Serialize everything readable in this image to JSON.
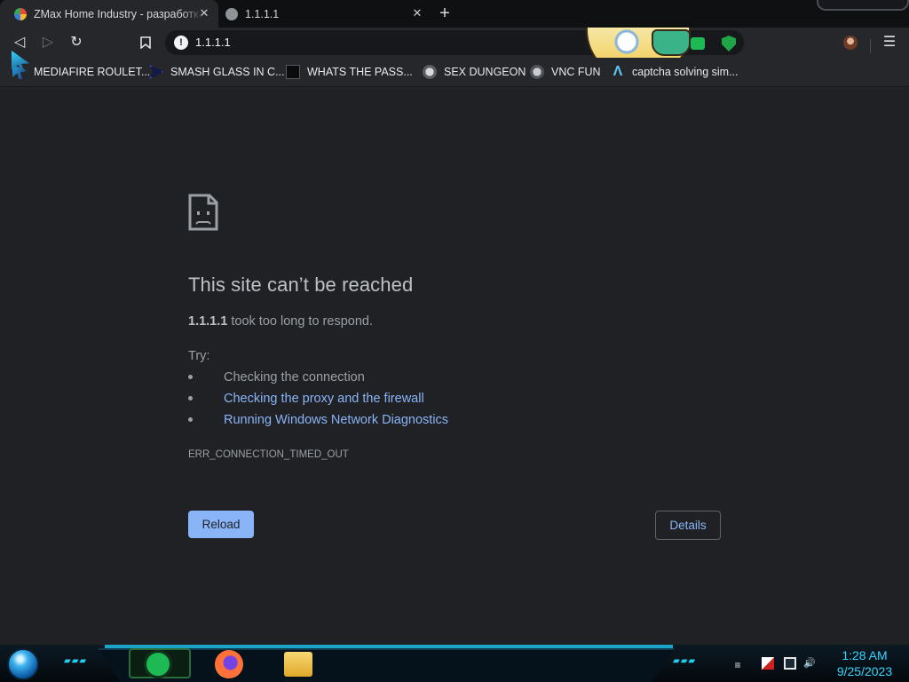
{
  "browser": {
    "tabs": [
      {
        "title": "ZMax Home Industry - разработка",
        "active": true
      },
      {
        "title": "1.1.1.1",
        "active": false
      }
    ],
    "new_tab_label": "+",
    "address_bar": {
      "url": "1.1.1.1",
      "security_icon": "info-icon"
    },
    "toolbar_icons": [
      "back-icon",
      "forward-icon",
      "reload-icon",
      "bookmark-icon",
      "extension-icon",
      "shield-extension-icon",
      "profile-avatar",
      "menu-icon"
    ],
    "bookmarks": [
      {
        "label": "MEDIAFIRE ROULET...",
        "icon": "mediafire-icon"
      },
      {
        "label": "SMASH GLASS IN C...",
        "icon": "smash-glass-icon"
      },
      {
        "label": "WHATS THE PASS...",
        "icon": "whats-pass-icon"
      },
      {
        "label": "SEX DUNGEON",
        "icon": "globe-icon"
      },
      {
        "label": "VNC FUN",
        "icon": "globe-icon"
      },
      {
        "label": "captcha solving sim...",
        "icon": "captcha-icon"
      }
    ]
  },
  "error_page": {
    "icon": "sad-file-icon",
    "title": "This site can’t be reached",
    "host": "1.1.1.1",
    "message_rest": " took too long to respond.",
    "try_label": "Try:",
    "suggestions": [
      {
        "text": "Checking the connection",
        "is_link": false
      },
      {
        "text": "Checking the proxy and the firewall",
        "is_link": true
      },
      {
        "text": "Running Windows Network Diagnostics",
        "is_link": true
      }
    ],
    "error_code": "ERR_CONNECTION_TIMED_OUT",
    "reload_label": "Reload",
    "details_label": "Details",
    "colors": {
      "link": "#8ab4f8",
      "background": "#202124",
      "text": "#9aa0a6"
    }
  },
  "taskbar": {
    "apps": [
      "spotify-icon",
      "firefox-icon",
      "file-explorer-icon"
    ],
    "tray_icons": [
      "action-center-flag-icon",
      "network-icon",
      "volume-icon"
    ],
    "clock_time": "1:28 AM",
    "clock_date": "9/25/2023",
    "accent_color": "#33d6ff"
  }
}
